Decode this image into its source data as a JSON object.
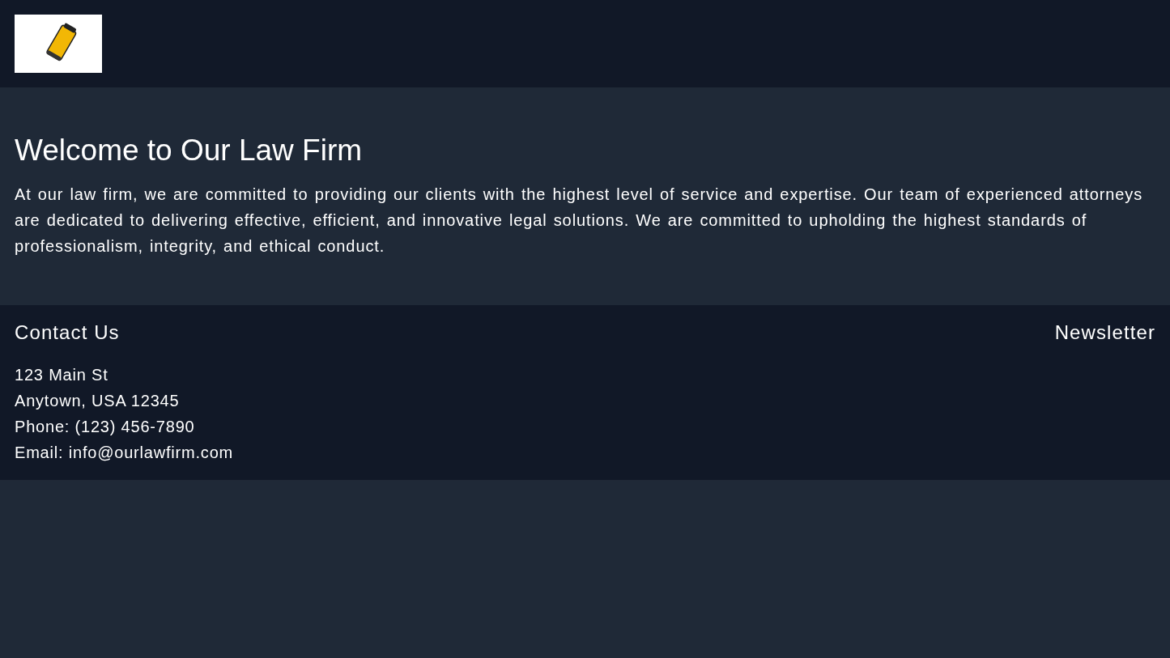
{
  "hero": {
    "title": "Welcome to Our Law Firm",
    "body": "At our law firm, we are committed to providing our clients with the highest level of service and expertise. Our team of experienced attorneys are dedicated to delivering effective, efficient, and innovative legal solutions. We are committed to upholding the highest standards of professionalism, integrity, and ethical conduct."
  },
  "footer": {
    "contact": {
      "heading": "Contact Us",
      "lines": [
        "123 Main St",
        "Anytown, USA 12345",
        "Phone: (123) 456-7890",
        "Email: info@ourlawfirm.com"
      ]
    },
    "newsletter": {
      "heading": "Newsletter"
    }
  }
}
